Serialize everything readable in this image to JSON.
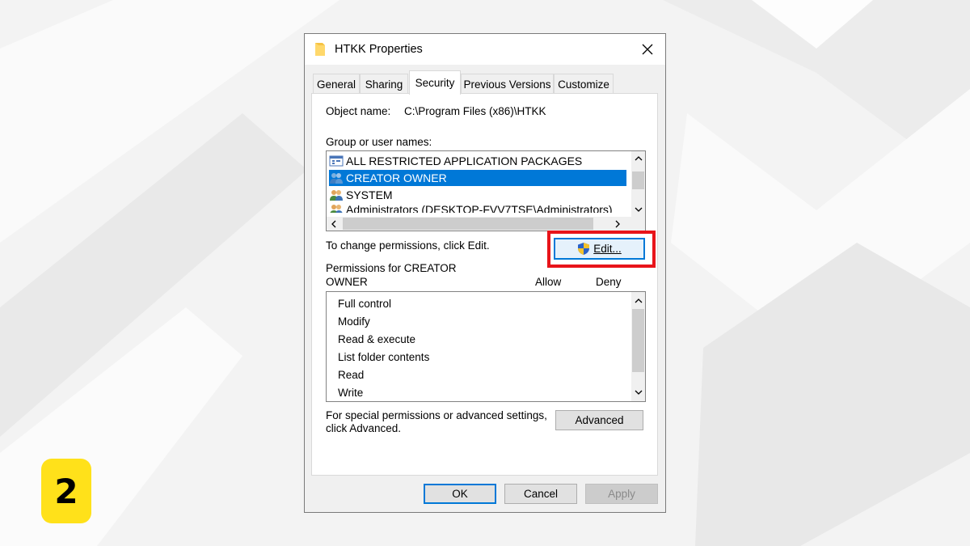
{
  "step_badge": "2",
  "dialog": {
    "title": "HTKK Properties",
    "title_icon": "folder-icon",
    "close_icon": "close-icon",
    "tabs": [
      {
        "label": "General",
        "active": false
      },
      {
        "label": "Sharing",
        "active": false
      },
      {
        "label": "Security",
        "active": true
      },
      {
        "label": "Previous Versions",
        "active": false
      },
      {
        "label": "Customize",
        "active": false
      }
    ]
  },
  "security": {
    "object_name_label": "Object name:",
    "object_name_value": "C:\\Program Files (x86)\\HTKK",
    "group_label": "Group or user names:",
    "groups": [
      {
        "name": "ALL RESTRICTED APPLICATION PACKAGES",
        "icon": "app-packages-icon",
        "selected": false
      },
      {
        "name": "CREATOR OWNER",
        "icon": "users-group-icon",
        "selected": true
      },
      {
        "name": "SYSTEM",
        "icon": "users-group-icon",
        "selected": false
      },
      {
        "name": "Administrators (DESKTOP-FVV7TSE\\Administrators)",
        "icon": "users-group-icon",
        "selected": false
      }
    ],
    "change_text": "To change permissions, click Edit.",
    "edit_label": "Edit...",
    "edit_icon": "uac-shield-icon",
    "permissions_label_line1": "Permissions for CREATOR",
    "permissions_label_line2": "OWNER",
    "allow_header": "Allow",
    "deny_header": "Deny",
    "permissions": [
      "Full control",
      "Modify",
      "Read & execute",
      "List folder contents",
      "Read",
      "Write"
    ],
    "advanced_text_line1": "For special permissions or advanced settings,",
    "advanced_text_line2": "click Advanced.",
    "advanced_label": "Advanced"
  },
  "footer": {
    "ok_label": "OK",
    "cancel_label": "Cancel",
    "apply_label": "Apply"
  },
  "colors": {
    "selection": "#0078d7",
    "highlight": "#e8141a",
    "badge": "#ffe11a"
  }
}
